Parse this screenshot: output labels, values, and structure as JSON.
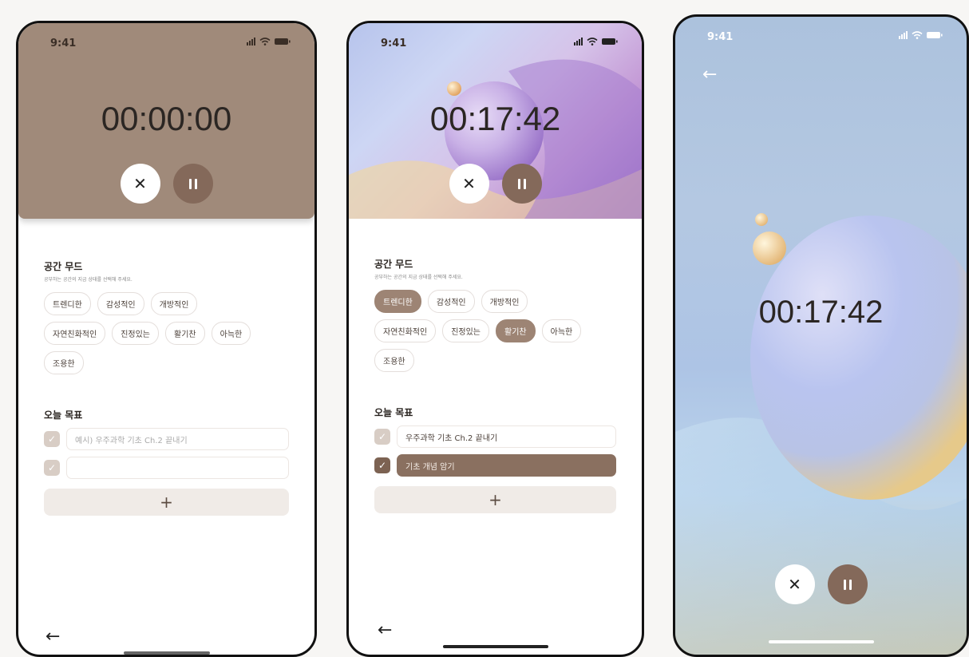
{
  "screens": [
    {
      "status_time": "9:41",
      "timer": "00:00:00",
      "mood_title": "공간 무드",
      "mood_sub": "공부하는 공간의 지금 상태를 선택해 주세요.",
      "chips": [
        {
          "label": "트렌디한",
          "selected": false
        },
        {
          "label": "감성적인",
          "selected": false
        },
        {
          "label": "개방적인",
          "selected": false
        },
        {
          "label": "자연친화적인",
          "selected": false
        },
        {
          "label": "진정있는",
          "selected": false
        },
        {
          "label": "활기찬",
          "selected": false
        },
        {
          "label": "아늑한",
          "selected": false
        },
        {
          "label": "조용한",
          "selected": false
        }
      ],
      "goals_title": "오늘 목표",
      "goals": [
        {
          "text": "",
          "placeholder": "예시) 우주과학 기초 Ch.2 끝내기",
          "checked": false
        },
        {
          "text": "",
          "placeholder": "",
          "checked": false
        }
      ],
      "add_label": "+",
      "back_label": "←"
    },
    {
      "status_time": "9:41",
      "timer": "00:17:42",
      "mood_title": "공간 무드",
      "mood_sub": "공부하는 공간의 지금 상태를 선택해 주세요.",
      "chips": [
        {
          "label": "트렌디한",
          "selected": true
        },
        {
          "label": "감성적인",
          "selected": false
        },
        {
          "label": "개방적인",
          "selected": false
        },
        {
          "label": "자연친화적인",
          "selected": false
        },
        {
          "label": "진정있는",
          "selected": false
        },
        {
          "label": "활기찬",
          "selected": true
        },
        {
          "label": "아늑한",
          "selected": false
        },
        {
          "label": "조용한",
          "selected": false
        }
      ],
      "goals_title": "오늘 목표",
      "goals": [
        {
          "text": "우주과학 기초 Ch.2 끝내기",
          "placeholder": "",
          "checked": false
        },
        {
          "text": "기초 개념 암기",
          "placeholder": "",
          "checked": true
        }
      ],
      "add_label": "+",
      "back_label": "←"
    },
    {
      "status_time": "9:41",
      "timer": "00:17:42",
      "back_label": "←"
    }
  ],
  "controls": {
    "close_label": "✕"
  },
  "colors": {
    "brown": "#a08a7a",
    "pause": "#84695a",
    "selected_chip": "#9d8474",
    "checked_box": "#7c6252"
  }
}
